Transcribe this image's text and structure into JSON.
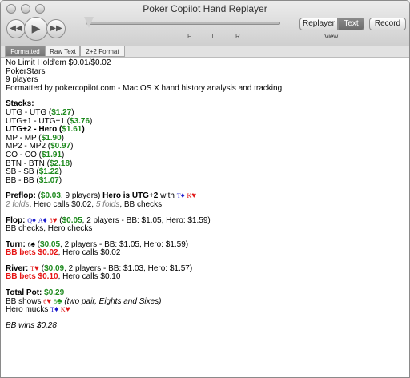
{
  "window": {
    "title": "Poker Copilot Hand Replayer"
  },
  "toolbar": {
    "rewind_icon": "rewind-icon",
    "play_icon": "play-icon",
    "fastforward_icon": "fast-forward-icon",
    "street_markers": [
      "F",
      "T",
      "R"
    ],
    "view_options": [
      "Replayer",
      "Text"
    ],
    "view_selected": "Text",
    "view_label": "View",
    "record_label": "Record"
  },
  "tabs": [
    "Formatted",
    "Raw Text",
    "2+2 Format"
  ],
  "tab_selected": "Formatted",
  "hand": {
    "header": [
      "No Limit Hold'em $0.01/$0.02",
      "PokerStars",
      "9 players",
      "Formatted by pokercopilot.com - Mac OS X hand history analysis and tracking"
    ],
    "stacks_label": "Stacks:",
    "stacks": [
      {
        "pos": "UTG - UTG",
        "amt": "$1.27"
      },
      {
        "pos": "UTG+1 - UTG+1",
        "amt": "$3.76"
      },
      {
        "pos": "UTG+2 - Hero",
        "amt": "$1.61"
      },
      {
        "pos": "MP - MP",
        "amt": "$1.90"
      },
      {
        "pos": "MP2 - MP2",
        "amt": "$0.97"
      },
      {
        "pos": "CO - CO",
        "amt": "$1.91"
      },
      {
        "pos": "BTN - BTN",
        "amt": "$2.18"
      },
      {
        "pos": "SB - SB",
        "amt": "$1.22"
      },
      {
        "pos": "BB - BB",
        "amt": "$1.07"
      }
    ],
    "preflop": {
      "label": "Preflop:",
      "pot": "$0.03",
      "players": ", 9 players)",
      "hero": "Hero is UTG+2",
      "with": " with ",
      "cards": [
        {
          "rank": "T",
          "suit": "♦",
          "color": "blue"
        },
        {
          "rank": "K",
          "suit": "♥",
          "color": "red"
        }
      ],
      "action_folds1": "2 folds",
      "action_mid": ", Hero calls $0.02, ",
      "action_folds2": "5 folds",
      "action_end": ", BB checks"
    },
    "flop": {
      "label": "Flop:",
      "cards": [
        {
          "rank": "Q",
          "suit": "♦",
          "color": "blue"
        },
        {
          "rank": "A",
          "suit": "♦",
          "color": "blue"
        },
        {
          "rank": "8",
          "suit": "♥",
          "color": "red"
        }
      ],
      "pot": "$0.05",
      "info": ", 2 players - BB: $1.05, Hero: $1.59)",
      "action": "BB checks, Hero checks"
    },
    "turn": {
      "label": "Turn:",
      "card": {
        "rank": "6",
        "suit": "♠",
        "color": "black"
      },
      "pot": "$0.05",
      "info": ", 2 players - BB: $1.05, Hero: $1.59)",
      "bet": "BB bets $0.02",
      "action": ", Hero calls $0.02"
    },
    "river": {
      "label": "River:",
      "card": {
        "rank": "T",
        "suit": "♥",
        "color": "red"
      },
      "pot": "$0.09",
      "info": ", 2 players - BB: $1.03, Hero: $1.57)",
      "bet": "BB bets $0.10",
      "action": ", Hero calls $0.10"
    },
    "total": {
      "label": "Total Pot:",
      "pot": "$0.29",
      "bb_shows": "BB shows ",
      "bb_cards": [
        {
          "rank": "6",
          "suit": "♥",
          "color": "red"
        },
        {
          "rank": "8",
          "suit": "♣",
          "color": "green"
        }
      ],
      "bb_desc": "(two pair, Eights and Sixes)",
      "hero_mucks": "Hero mucks ",
      "hero_cards": [
        {
          "rank": "T",
          "suit": "♦",
          "color": "blue"
        },
        {
          "rank": "K",
          "suit": "♥",
          "color": "red"
        }
      ]
    },
    "result": "BB wins $0.28"
  }
}
